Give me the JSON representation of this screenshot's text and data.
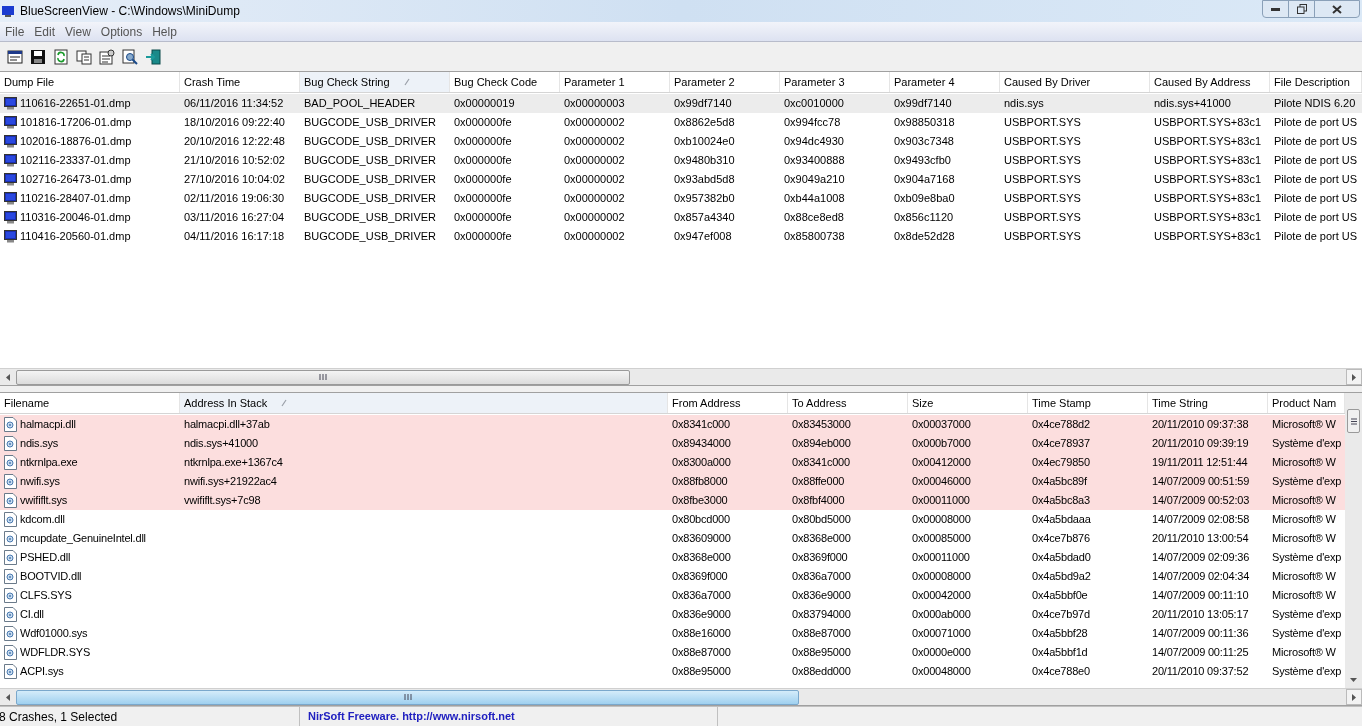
{
  "window": {
    "title": "BlueScreenView  -  C:\\Windows\\MiniDump"
  },
  "menu": [
    "File",
    "Edit",
    "View",
    "Options",
    "Help"
  ],
  "crash_table": {
    "columns": [
      {
        "label": "Dump File",
        "sorted": false
      },
      {
        "label": "Crash Time",
        "sorted": false
      },
      {
        "label": "Bug Check String",
        "sorted": true
      },
      {
        "label": "Bug Check Code",
        "sorted": false
      },
      {
        "label": "Parameter 1",
        "sorted": false
      },
      {
        "label": "Parameter 2",
        "sorted": false
      },
      {
        "label": "Parameter 3",
        "sorted": false
      },
      {
        "label": "Parameter 4",
        "sorted": false
      },
      {
        "label": "Caused By Driver",
        "sorted": false
      },
      {
        "label": "Caused By Address",
        "sorted": false
      },
      {
        "label": "File Description",
        "sorted": false
      }
    ],
    "rows": [
      {
        "selected": true,
        "cells": [
          "110616-22651-01.dmp",
          "06/11/2016 11:34:52",
          "BAD_POOL_HEADER",
          "0x00000019",
          "0x00000003",
          "0x99df7140",
          "0xc0010000",
          "0x99df7140",
          "ndis.sys",
          "ndis.sys+41000",
          "Pilote NDIS 6.20"
        ]
      },
      {
        "selected": false,
        "cells": [
          "101816-17206-01.dmp",
          "18/10/2016 09:22:40",
          "BUGCODE_USB_DRIVER",
          "0x000000fe",
          "0x00000002",
          "0x8862e5d8",
          "0x994fcc78",
          "0x98850318",
          "USBPORT.SYS",
          "USBPORT.SYS+83c1",
          "Pilote de port US"
        ]
      },
      {
        "selected": false,
        "cells": [
          "102016-18876-01.dmp",
          "20/10/2016 12:22:48",
          "BUGCODE_USB_DRIVER",
          "0x000000fe",
          "0x00000002",
          "0xb10024e0",
          "0x94dc4930",
          "0x903c7348",
          "USBPORT.SYS",
          "USBPORT.SYS+83c1",
          "Pilote de port US"
        ]
      },
      {
        "selected": false,
        "cells": [
          "102116-23337-01.dmp",
          "21/10/2016 10:52:02",
          "BUGCODE_USB_DRIVER",
          "0x000000fe",
          "0x00000002",
          "0x9480b310",
          "0x93400888",
          "0x9493cfb0",
          "USBPORT.SYS",
          "USBPORT.SYS+83c1",
          "Pilote de port US"
        ]
      },
      {
        "selected": false,
        "cells": [
          "102716-26473-01.dmp",
          "27/10/2016 10:04:02",
          "BUGCODE_USB_DRIVER",
          "0x000000fe",
          "0x00000002",
          "0x93abd5d8",
          "0x9049a210",
          "0x904a7168",
          "USBPORT.SYS",
          "USBPORT.SYS+83c1",
          "Pilote de port US"
        ]
      },
      {
        "selected": false,
        "cells": [
          "110216-28407-01.dmp",
          "02/11/2016 19:06:30",
          "BUGCODE_USB_DRIVER",
          "0x000000fe",
          "0x00000002",
          "0x957382b0",
          "0xb44a1008",
          "0xb09e8ba0",
          "USBPORT.SYS",
          "USBPORT.SYS+83c1",
          "Pilote de port US"
        ]
      },
      {
        "selected": false,
        "cells": [
          "110316-20046-01.dmp",
          "03/11/2016 16:27:04",
          "BUGCODE_USB_DRIVER",
          "0x000000fe",
          "0x00000002",
          "0x857a4340",
          "0x88ce8ed8",
          "0x856c1120",
          "USBPORT.SYS",
          "USBPORT.SYS+83c1",
          "Pilote de port US"
        ]
      },
      {
        "selected": false,
        "cells": [
          "110416-20560-01.dmp",
          "04/11/2016 16:17:18",
          "BUGCODE_USB_DRIVER",
          "0x000000fe",
          "0x00000002",
          "0x947ef008",
          "0x85800738",
          "0x8de52d28",
          "USBPORT.SYS",
          "USBPORT.SYS+83c1",
          "Pilote de port US"
        ]
      }
    ]
  },
  "module_table": {
    "columns": [
      {
        "label": "Filename",
        "sorted": false
      },
      {
        "label": "Address In Stack",
        "sorted": true
      },
      {
        "label": "From Address",
        "sorted": false
      },
      {
        "label": "To Address",
        "sorted": false
      },
      {
        "label": "Size",
        "sorted": false
      },
      {
        "label": "Time Stamp",
        "sorted": false
      },
      {
        "label": "Time String",
        "sorted": false
      },
      {
        "label": "Product Nam",
        "sorted": false
      }
    ],
    "rows": [
      {
        "highlighted": true,
        "cells": [
          "halmacpi.dll",
          "halmacpi.dll+37ab",
          "0x8341c000",
          "0x83453000",
          "0x00037000",
          "0x4ce788d2",
          "20/11/2010 09:37:38",
          "Microsoft® W"
        ]
      },
      {
        "highlighted": true,
        "cells": [
          "ndis.sys",
          "ndis.sys+41000",
          "0x89434000",
          "0x894eb000",
          "0x000b7000",
          "0x4ce78937",
          "20/11/2010 09:39:19",
          "Système d'exp"
        ]
      },
      {
        "highlighted": true,
        "cells": [
          "ntkrnlpa.exe",
          "ntkrnlpa.exe+1367c4",
          "0x8300a000",
          "0x8341c000",
          "0x00412000",
          "0x4ec79850",
          "19/11/2011 12:51:44",
          "Microsoft® W"
        ]
      },
      {
        "highlighted": true,
        "cells": [
          "nwifi.sys",
          "nwifi.sys+21922ac4",
          "0x88fb8000",
          "0x88ffe000",
          "0x00046000",
          "0x4a5bc89f",
          "14/07/2009 00:51:59",
          "Système d'exp"
        ]
      },
      {
        "highlighted": true,
        "cells": [
          "vwififlt.sys",
          "vwififlt.sys+7c98",
          "0x8fbe3000",
          "0x8fbf4000",
          "0x00011000",
          "0x4a5bc8a3",
          "14/07/2009 00:52:03",
          "Microsoft® W"
        ]
      },
      {
        "highlighted": false,
        "cells": [
          "kdcom.dll",
          "",
          "0x80bcd000",
          "0x80bd5000",
          "0x00008000",
          "0x4a5bdaaa",
          "14/07/2009 02:08:58",
          "Microsoft® W"
        ]
      },
      {
        "highlighted": false,
        "cells": [
          "mcupdate_GenuineIntel.dll",
          "",
          "0x83609000",
          "0x8368e000",
          "0x00085000",
          "0x4ce7b876",
          "20/11/2010 13:00:54",
          "Microsoft® W"
        ]
      },
      {
        "highlighted": false,
        "cells": [
          "PSHED.dll",
          "",
          "0x8368e000",
          "0x8369f000",
          "0x00011000",
          "0x4a5bdad0",
          "14/07/2009 02:09:36",
          "Système d'exp"
        ]
      },
      {
        "highlighted": false,
        "cells": [
          "BOOTVID.dll",
          "",
          "0x8369f000",
          "0x836a7000",
          "0x00008000",
          "0x4a5bd9a2",
          "14/07/2009 02:04:34",
          "Microsoft® W"
        ]
      },
      {
        "highlighted": false,
        "cells": [
          "CLFS.SYS",
          "",
          "0x836a7000",
          "0x836e9000",
          "0x00042000",
          "0x4a5bbf0e",
          "14/07/2009 00:11:10",
          "Microsoft® W"
        ]
      },
      {
        "highlighted": false,
        "cells": [
          "CI.dll",
          "",
          "0x836e9000",
          "0x83794000",
          "0x000ab000",
          "0x4ce7b97d",
          "20/11/2010 13:05:17",
          "Système d'exp"
        ]
      },
      {
        "highlighted": false,
        "cells": [
          "Wdf01000.sys",
          "",
          "0x88e16000",
          "0x88e87000",
          "0x00071000",
          "0x4a5bbf28",
          "14/07/2009 00:11:36",
          "Système d'exp"
        ]
      },
      {
        "highlighted": false,
        "cells": [
          "WDFLDR.SYS",
          "",
          "0x88e87000",
          "0x88e95000",
          "0x0000e000",
          "0x4a5bbf1d",
          "14/07/2009 00:11:25",
          "Microsoft® W"
        ]
      },
      {
        "highlighted": false,
        "cells": [
          "ACPI.sys",
          "",
          "0x88e95000",
          "0x88edd000",
          "0x00048000",
          "0x4ce788e0",
          "20/11/2010 09:37:52",
          "Système d'exp"
        ]
      }
    ]
  },
  "status_bar": {
    "count": "8 Crashes, 1 Selected",
    "credit": "NirSoft Freeware.  http://www.nirsoft.net"
  }
}
